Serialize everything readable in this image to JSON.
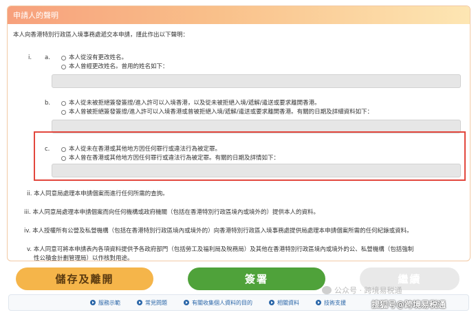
{
  "header": {
    "title": "申請人的聲明"
  },
  "intro": "本人向香港特別行政區入境事務處遞交本申請，謹此作出以下聲明：",
  "section_i": {
    "numeral": "i.",
    "a": {
      "letter": "a.",
      "option1": "本人從沒有更改姓名。",
      "option2": "本人曾經更改姓名。曾用的姓名如下："
    },
    "b": {
      "letter": "b.",
      "option1": "本人從未被拒絕簽發簽證/進入許可以入境香港，以及從未被拒絕入境/遞解/遣送或要求離開香港。",
      "option2": "本人曾被拒絕簽發簽證/進入許可以入境香港或曾被拒絕入境/遞解/遣送或要求離開香港。有關的日期及詳細資料如下："
    },
    "c": {
      "letter": "c.",
      "option1": "本人從未在香港或其他地方因任何罪行或違法行為被定罪。",
      "option2": "本人曾在香港或其他地方因任何罪行或違法行為被定罪。有關的日期及詳情如下："
    }
  },
  "statements": {
    "ii": "ii. 本人同意局處理本申請個案而進行任何所需的查詢。",
    "iii": "iii. 本人同意局處理本申請個案而向任何機構或政府機關（包括在香港特別行政區境內或境外的）提供本人的資料。",
    "iv": "iv. 本人授權所有公營及私營機構（包括在香港特別行政區境內或境外的）向香港特別行政區入境事務處提供局處理本申請個案所需的任何紀錄或資料。",
    "v_line1": "v. 本人同意可將本申請表內各項資料提供予各政府部門（包括勞工及福利局及稅務局）及其他在香港特別行政區境內或境外的公、私營機構（包括強制",
    "v_line2": "性公積金計劃管理局）以作核對用途。"
  },
  "buttons": {
    "save": "儲存及離開",
    "sign": "簽署",
    "next": "繼續"
  },
  "footer": {
    "links": [
      "服務示範",
      "常見問題",
      "有關收集個人資料的目的",
      "相關資料",
      "技術支援"
    ]
  },
  "watermark": {
    "line1": "公众号 · 跨境易税通",
    "line2": "搜狐号@跨境易税通"
  },
  "colors": {
    "header_gradient_start": "#f7a07c",
    "highlight_border": "#e2463c",
    "save_button": "#f5b54a",
    "sign_button": "#4fa23a",
    "next_button": "#e9e9e9",
    "link_blue": "#2a66a8"
  }
}
